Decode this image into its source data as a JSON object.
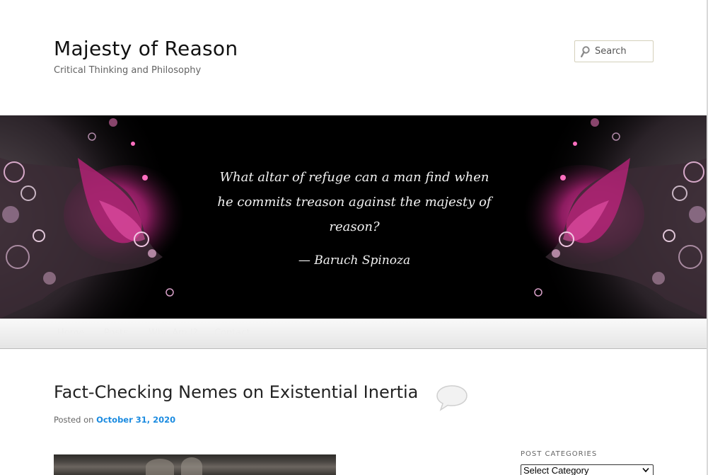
{
  "header": {
    "site_title": "Majesty of Reason",
    "site_description": "Critical Thinking and Philosophy"
  },
  "search": {
    "placeholder": "Search",
    "icon": "search-icon"
  },
  "banner": {
    "quote": "What altar of refuge can a man find when he commits treason against the majesty of reason?",
    "author": "— Baruch Spinoza"
  },
  "nav": {
    "items": [
      {
        "label": "Home"
      },
      {
        "label": "Posts"
      },
      {
        "label": "Who Am I?"
      },
      {
        "label": "Contact"
      }
    ]
  },
  "post": {
    "title": "Fact-Checking Nemes on Existential Inertia",
    "posted_on_label": "Posted on",
    "date": "October 31, 2020",
    "comment_icon": "comment-bubble-icon"
  },
  "sidebar": {
    "categories_title": "POST CATEGORIES",
    "category_select_value": "Select Category"
  },
  "colors": {
    "link": "#1b8be0",
    "banner_bg": "#000000",
    "banner_accent": "#c0237e"
  }
}
